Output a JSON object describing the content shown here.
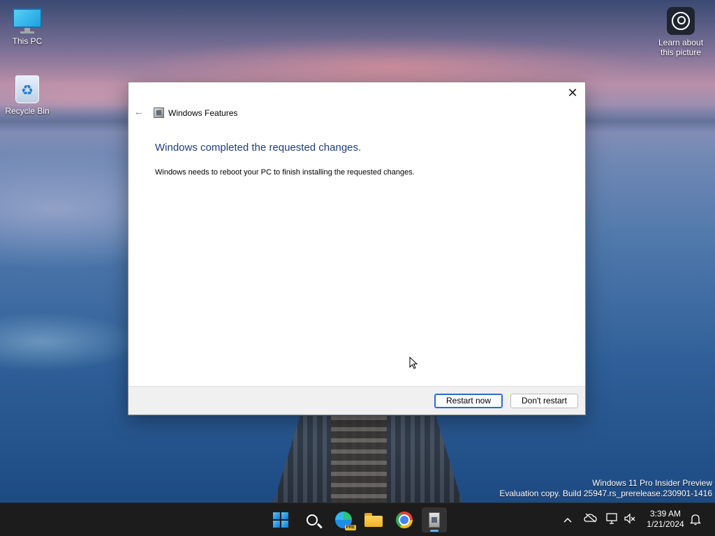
{
  "desktop": {
    "icons": [
      {
        "label": "This PC",
        "icon": "monitor-icon"
      },
      {
        "label": "Recycle Bin",
        "icon": "recycle-bin-icon"
      },
      {
        "label": "Learn about\nthis picture",
        "icon": "learn-about-picture-icon"
      }
    ],
    "watermark": {
      "line1": "Windows 11 Pro Insider Preview",
      "line2": "Evaluation copy. Build 25947.rs_prerelease.230901-1416"
    }
  },
  "dialog": {
    "title": "Windows Features",
    "heading": "Windows completed the requested changes.",
    "message": "Windows needs to reboot your PC to finish installing the requested changes.",
    "close_glyph": "✕",
    "back_glyph": "←",
    "buttons": {
      "restart": "Restart now",
      "dont_restart": "Don't restart"
    },
    "heading_color": "#1f3d7a",
    "primary_button_border": "#2a6ad1"
  },
  "taskbar": {
    "apps": [
      {
        "name": "Start",
        "icon": "windows-logo-icon"
      },
      {
        "name": "Search",
        "icon": "search-icon"
      },
      {
        "name": "Microsoft Edge Preview",
        "icon": "edge-icon",
        "badge": "PRE"
      },
      {
        "name": "File Explorer",
        "icon": "folder-icon"
      },
      {
        "name": "Google Chrome",
        "icon": "chrome-icon"
      },
      {
        "name": "Windows Features",
        "icon": "windows-features-icon",
        "active": true
      }
    ],
    "tray": {
      "chevron": "^",
      "icons": [
        "onedrive-icon",
        "network-icon",
        "volume-muted-icon",
        "notification-bell-icon"
      ],
      "time": "3:39 AM",
      "date": "1/21/2024"
    }
  }
}
